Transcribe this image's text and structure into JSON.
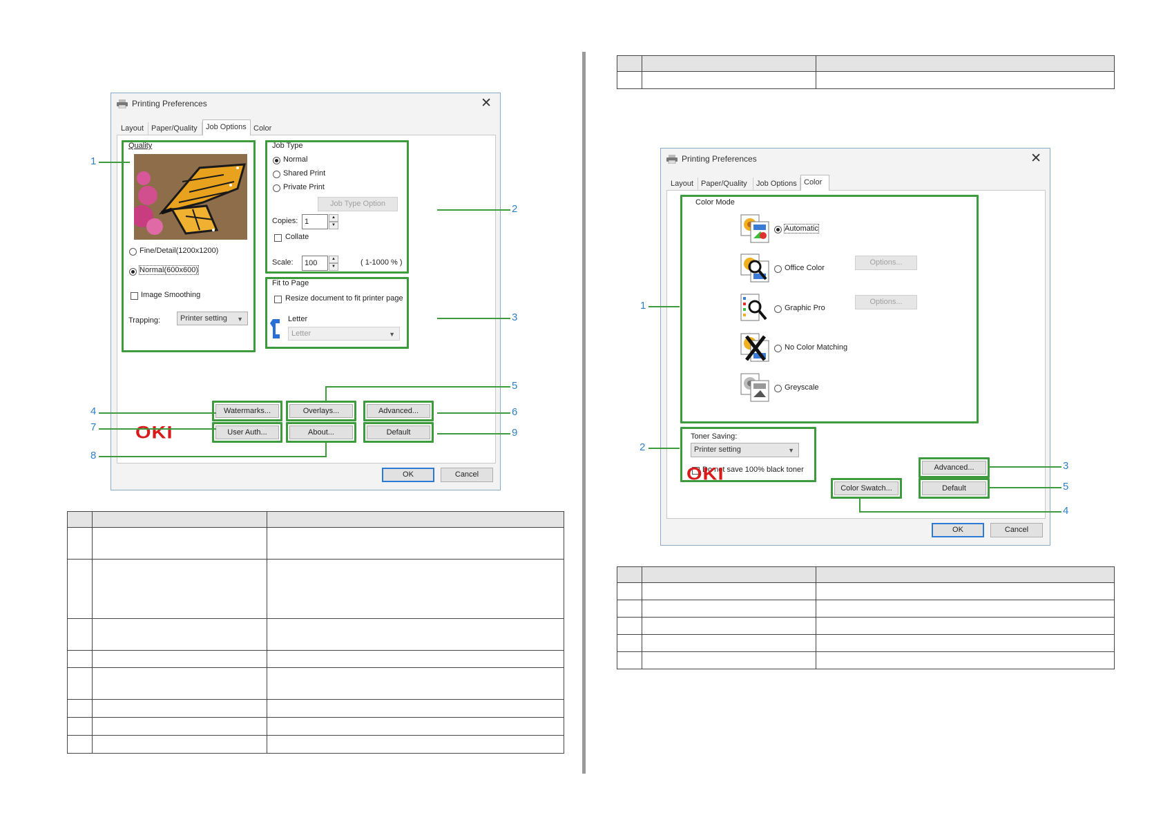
{
  "left_dialog": {
    "title": "Printing Preferences",
    "tabs": [
      "Layout",
      "Paper/Quality",
      "Job Options",
      "Color"
    ],
    "active_tab": "Job Options",
    "quality": {
      "label": "Quality",
      "options": [
        "Fine/Detail(1200x1200)",
        "Normal(600x600)"
      ],
      "selected": "Normal(600x600)",
      "image_smoothing": "Image Smoothing",
      "trapping_label": "Trapping:",
      "trapping_value": "Printer setting"
    },
    "job_type": {
      "label": "Job Type",
      "options": [
        "Normal",
        "Shared Print",
        "Private Print"
      ],
      "selected": "Normal",
      "option_button": "Job Type Option",
      "copies_label": "Copies:",
      "copies_value": "1",
      "collate": "Collate",
      "scale_label": "Scale:",
      "scale_value": "100",
      "scale_range": "( 1-1000 % )"
    },
    "fit_to_page": {
      "label": "Fit to Page",
      "resize": "Resize document to fit printer page",
      "paper_label": "Letter",
      "paper_value": "Letter"
    },
    "buttons": {
      "watermarks": "Watermarks...",
      "overlays": "Overlays...",
      "advanced": "Advanced...",
      "user_auth": "User Auth...",
      "about": "About...",
      "default": "Default",
      "ok": "OK",
      "cancel": "Cancel"
    },
    "logo": "OKI",
    "callouts": [
      "1",
      "2",
      "3",
      "4",
      "5",
      "6",
      "7",
      "8",
      "9"
    ]
  },
  "right_dialog": {
    "title": "Printing Preferences",
    "tabs": [
      "Layout",
      "Paper/Quality",
      "Job Options",
      "Color"
    ],
    "active_tab": "Color",
    "color_mode": {
      "label": "Color Mode",
      "options": [
        "Automatic",
        "Office Color",
        "Graphic Pro",
        "No Color Matching",
        "Greyscale"
      ],
      "selected": "Automatic",
      "options_button": "Options..."
    },
    "toner_saving": {
      "label": "Toner Saving:",
      "value": "Printer setting",
      "black_toner": "Do not save 100% black toner"
    },
    "buttons": {
      "advanced": "Advanced...",
      "default": "Default",
      "color_swatch": "Color Swatch...",
      "ok": "OK",
      "cancel": "Cancel"
    },
    "logo": "OKI",
    "callouts": [
      "1",
      "2",
      "3",
      "4",
      "5"
    ]
  }
}
